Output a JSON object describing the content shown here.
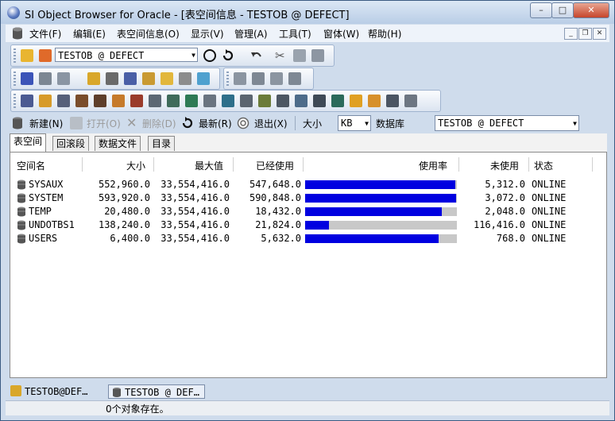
{
  "window": {
    "title": "SI Object Browser for Oracle - [表空间信息 - TESTOB @ DEFECT]",
    "minimize": "–",
    "maximize": "□",
    "close": "✕"
  },
  "menu": {
    "items": [
      "文件(F)",
      "编辑(E)",
      "表空间信息(O)",
      "显示(V)",
      "管理(A)",
      "工具(T)",
      "窗体(W)",
      "帮助(H)"
    ],
    "mdi_min": "_",
    "mdi_restore": "❐",
    "mdi_close": "✕"
  },
  "toolbar": {
    "connection": "TESTOB @ DEFECT",
    "arrow": "▼"
  },
  "actions": {
    "new": "新建(N)",
    "open": "打开(O)",
    "delete": "删除(D)",
    "refresh": "最新(R)",
    "exit": "退出(X)",
    "size_label": "大小",
    "unit": "KB",
    "db_label": "数据库",
    "database": "TESTOB @ DEFECT",
    "arrow": "▼"
  },
  "tabs": [
    "表空间",
    "回滚段",
    "数据文件",
    "目录"
  ],
  "table": {
    "columns": [
      "空间名",
      "大小",
      "最大值",
      "已经使用",
      "使用率",
      "未使用",
      "状态"
    ],
    "rows": [
      {
        "name": "SYSAUX",
        "size": "552,960.0",
        "max": "33,554,416.0",
        "used": "547,648.0",
        "rate": 0.99,
        "free": "5,312.0",
        "status": "ONLINE"
      },
      {
        "name": "SYSTEM",
        "size": "593,920.0",
        "max": "33,554,416.0",
        "used": "590,848.0",
        "rate": 0.995,
        "free": "3,072.0",
        "status": "ONLINE"
      },
      {
        "name": "TEMP",
        "size": "20,480.0",
        "max": "33,554,416.0",
        "used": "18,432.0",
        "rate": 0.9,
        "free": "2,048.0",
        "status": "ONLINE"
      },
      {
        "name": "UNDOTBS1",
        "size": "138,240.0",
        "max": "33,554,416.0",
        "used": "21,824.0",
        "rate": 0.158,
        "free": "116,416.0",
        "status": "ONLINE"
      },
      {
        "name": "USERS",
        "size": "6,400.0",
        "max": "33,554,416.0",
        "used": "5,632.0",
        "rate": 0.88,
        "free": "768.0",
        "status": "ONLINE"
      }
    ]
  },
  "taskbar": {
    "item1": "TESTOB@DEF…",
    "item2": "TESTOB @ DEF…"
  },
  "status": {
    "text": "0个对象存在。"
  },
  "colors": {
    "bar": "#0000e0",
    "bar_bg": "#c8c8c8"
  }
}
